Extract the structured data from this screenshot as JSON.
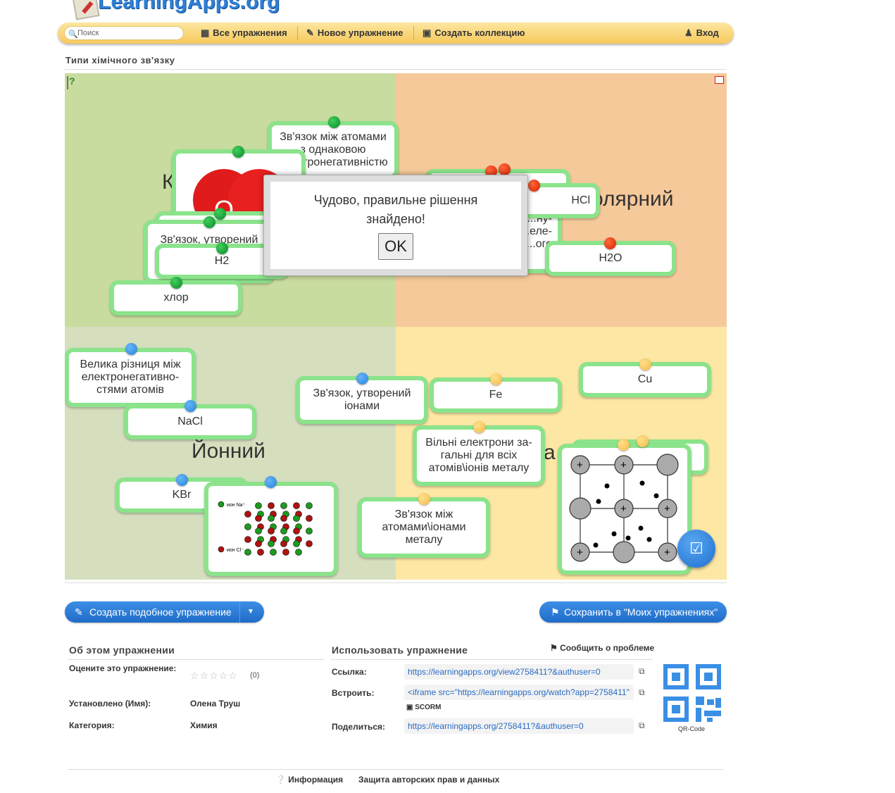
{
  "logo": {
    "text": "LearningApps.org"
  },
  "nav": {
    "search_placeholder": "Поиск",
    "all_exercises": "Все упражнения",
    "new_exercise": "Новое упражнение",
    "create_collection": "Создать коллекцию",
    "login": "Вход"
  },
  "page": {
    "title": "Типи хімічного зв'язку"
  },
  "app": {
    "quadrants": [
      {
        "label": "К",
        "color": "#c9dc9f"
      },
      {
        "label": "олярний",
        "color": "#f6c99a"
      },
      {
        "label": "Йонний",
        "color": "#d5dfbe"
      },
      {
        "label": "а",
        "color": "#fce7a4"
      }
    ],
    "cards": {
      "c1": "Зв'язок між атомами з однаковою електронегативністю",
      "c2": "О О",
      "c3": "Зв'язок, утворений з...",
      "c4": "H2",
      "c5": "хлор",
      "c6": "HCl",
      "c7": "...ну-\n...еле-\n...ого",
      "c8": "H2O",
      "c9": "Велика різниця між електронегативно-стями атомів",
      "c10": "NaCl",
      "c11": "KBr",
      "c12": "Зв'язок, утворений іонами",
      "c13": "Fe",
      "c14": "Cu",
      "c15": "Вільні електрони за-гальні для всіх атомів\\іонів металу",
      "c16": "Зв'язок між атомами\\іонами металу",
      "nacl_legend_na": "ион Na⁺",
      "nacl_legend_cl": "ион Cl⁻"
    },
    "modal": {
      "message": "Чудово, правильне рішення знайдено!",
      "ok": "OK"
    },
    "colors": {
      "card_border": "#8be38b",
      "pin_green": "#13a33a",
      "pin_red": "#f03010",
      "pin_blue": "#3a93e0",
      "pin_yellow": "#f8c867"
    }
  },
  "actions": {
    "create_similar": "Создать подобное упражнение",
    "save_mine": "Сохранить в \"Моих упражнениях\""
  },
  "about": {
    "heading": "Об этом упражнении",
    "rate_label": "Оцените это упражнение:",
    "rate_count": "(0)",
    "author_label": "Установлено (Имя):",
    "author": "Олена Труш",
    "category_label": "Категория:",
    "category": "Химия"
  },
  "use": {
    "heading": "Использовать упражнение",
    "report": "Сообщить о проблеме",
    "link_label": "Ссылка:",
    "link": "https://learningapps.org/view2758411?&authuser=0",
    "embed_label": "Встроить:",
    "embed": "<iframe src=\"https://learningapps.org/watch?app=2758411\"",
    "scorm": "SCORM",
    "share_label": "Поделиться:",
    "share": "https://learningapps.org/2758411?&authuser=0",
    "qr_label": "QR-Code"
  },
  "footer": {
    "info": "Информация",
    "privacy": "Защита авторских прав и данных"
  }
}
